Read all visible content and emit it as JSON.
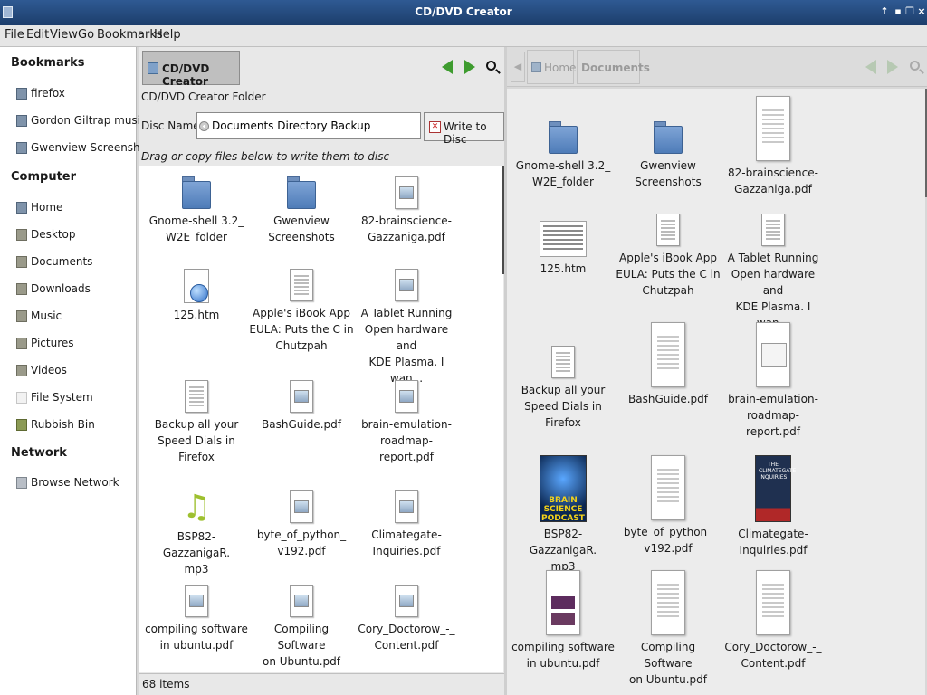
{
  "window": {
    "title": "CD/DVD Creator"
  },
  "menu": [
    "File",
    "Edit",
    "View",
    "Go",
    "Bookmarks",
    "Help"
  ],
  "sidebar": {
    "bookmarks_heading": "Bookmarks",
    "bookmarks": [
      "firefox",
      "Gordon Giltrap music...",
      "Gwenview Screenshots"
    ],
    "computer_heading": "Computer",
    "computer": [
      "Home",
      "Desktop",
      "Documents",
      "Downloads",
      "Music",
      "Pictures",
      "Videos",
      "File System",
      "Rubbish Bin"
    ],
    "network_heading": "Network",
    "network": [
      "Browse Network"
    ]
  },
  "left_pane": {
    "location": "CD/DVD Creator",
    "folder_label": "CD/DVD Creator Folder",
    "disc_name_label": "Disc Name:",
    "disc_name_value": "Documents Directory Backup",
    "write_button": "Write to Disc",
    "hint": "Drag or copy files below to write them to disc",
    "items": [
      {
        "name": "Gnome-shell 3.2_\nW2E_folder",
        "icon": "folder-icon"
      },
      {
        "name": "Gwenview\nScreenshots",
        "icon": "folder-icon"
      },
      {
        "name": "82-brainscience-\nGazzaniga.pdf",
        "icon": "pdf-icon"
      },
      {
        "name": "125.htm",
        "icon": "html-icon"
      },
      {
        "name": "Apple's iBook App\nEULA: Puts the C in\nChutzpah",
        "icon": "text-icon"
      },
      {
        "name": "A Tablet Running\nOpen hardware and\nKDE Plasma. I wan...",
        "icon": "pdf-icon"
      },
      {
        "name": "Backup all your\nSpeed Dials in\nFirefox",
        "icon": "text-icon"
      },
      {
        "name": "BashGuide.pdf",
        "icon": "pdf-icon"
      },
      {
        "name": "brain-emulation-\nroadmap-report.pdf",
        "icon": "pdf-icon"
      },
      {
        "name": "BSP82-GazzanigaR.\nmp3",
        "icon": "audio-icon"
      },
      {
        "name": "byte_of_python_\nv192.pdf",
        "icon": "pdf-icon"
      },
      {
        "name": "Climategate-\nInquiries.pdf",
        "icon": "pdf-icon"
      },
      {
        "name": "compiling software\nin ubuntu.pdf",
        "icon": "pdf-icon"
      },
      {
        "name": "Compiling Software\non Ubuntu.pdf",
        "icon": "pdf-icon"
      },
      {
        "name": "Cory_Doctorow_-_\nContent.pdf",
        "icon": "pdf-icon"
      }
    ],
    "status": "68 items"
  },
  "right_pane": {
    "crumb_home": "Home",
    "crumb_documents": "Documents",
    "items": [
      {
        "name": "Gnome-shell 3.2_\nW2E_folder",
        "icon": "folder-icon"
      },
      {
        "name": "Gwenview\nScreenshots",
        "icon": "folder-icon"
      },
      {
        "name": "82-brainscience-\nGazzaniga.pdf",
        "icon": "pdf-thumbnail"
      },
      {
        "name": "125.htm",
        "icon": "html-thumbnail"
      },
      {
        "name": "Apple's iBook App\nEULA: Puts the C in\nChutzpah",
        "icon": "text-icon"
      },
      {
        "name": "A Tablet Running\nOpen hardware and\nKDE Plasma. I wan...",
        "icon": "text-icon"
      },
      {
        "name": "Backup all your\nSpeed Dials in\nFirefox",
        "icon": "text-icon"
      },
      {
        "name": "BashGuide.pdf",
        "icon": "pdf-thumbnail"
      },
      {
        "name": "brain-emulation-\nroadmap-report.pdf",
        "icon": "pdf-thumbnail"
      },
      {
        "name": "BSP82-GazzanigaR.\nmp3",
        "icon": "podcast-cover"
      },
      {
        "name": "byte_of_python_\nv192.pdf",
        "icon": "pdf-thumbnail"
      },
      {
        "name": "Climategate-\nInquiries.pdf",
        "icon": "pdf-cover"
      },
      {
        "name": "compiling software\nin ubuntu.pdf",
        "icon": "pdf-thumbnail"
      },
      {
        "name": "Compiling Software\non Ubuntu.pdf",
        "icon": "pdf-thumbnail"
      },
      {
        "name": "Cory_Doctorow_-_\nContent.pdf",
        "icon": "pdf-thumbnail"
      }
    ],
    "podcast_cover_text": "BRAIN SCIENCE PODCAST",
    "climate_cover_text": "THE CLIMATEGATE INQUIRIES"
  }
}
